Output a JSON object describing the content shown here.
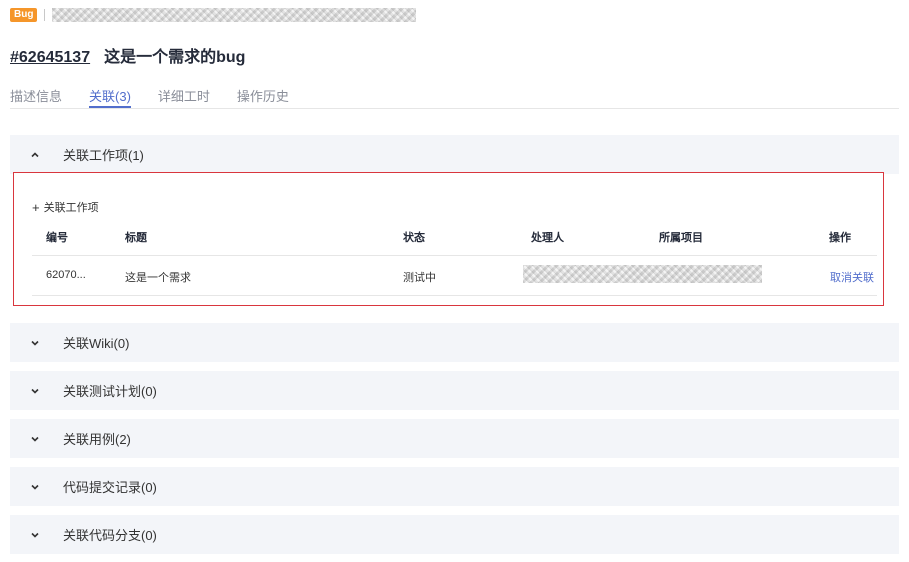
{
  "header": {
    "badge": "Bug",
    "issue_id": "#62645137",
    "issue_title": "这是一个需求的bug"
  },
  "tabs": [
    {
      "label": "描述信息"
    },
    {
      "label": "关联(3)"
    },
    {
      "label": "详细工时"
    },
    {
      "label": "操作历史"
    }
  ],
  "sections": {
    "work_items": {
      "label": "关联工作项(1)",
      "add_label": "关联工作项",
      "columns": {
        "id": "编号",
        "title": "标题",
        "status": "状态",
        "assignee": "处理人",
        "project": "所属项目",
        "action": "操作"
      },
      "rows": [
        {
          "id": "62070...",
          "title": "这是一个需求",
          "status": "测试中",
          "action": "取消关联"
        }
      ]
    },
    "wiki": {
      "label": "关联Wiki(0)"
    },
    "test_plan": {
      "label": "关联测试计划(0)"
    },
    "test_cases": {
      "label": "关联用例(2)"
    },
    "commits": {
      "label": "代码提交记录(0)"
    },
    "branches": {
      "label": "关联代码分支(0)"
    }
  },
  "colors": {
    "accent": "#526ecc",
    "badge": "#f5962a",
    "highlight_border": "#d9363e"
  }
}
